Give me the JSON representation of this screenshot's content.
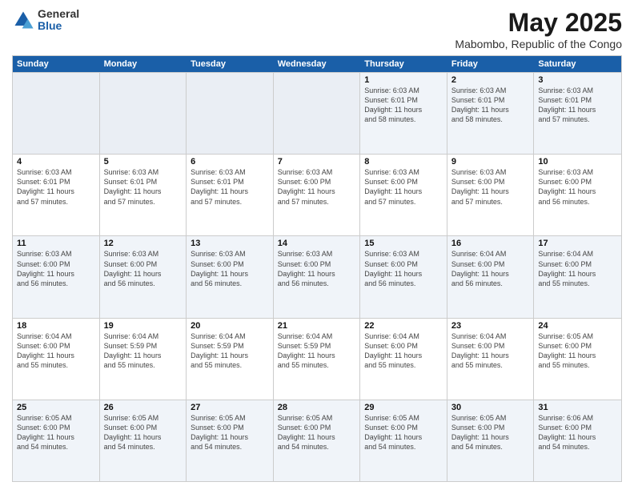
{
  "logo": {
    "general": "General",
    "blue": "Blue"
  },
  "header": {
    "title": "May 2025",
    "subtitle": "Mabombo, Republic of the Congo"
  },
  "weekdays": [
    "Sunday",
    "Monday",
    "Tuesday",
    "Wednesday",
    "Thursday",
    "Friday",
    "Saturday"
  ],
  "rows": [
    [
      {
        "day": "",
        "info": ""
      },
      {
        "day": "",
        "info": ""
      },
      {
        "day": "",
        "info": ""
      },
      {
        "day": "",
        "info": ""
      },
      {
        "day": "1",
        "info": "Sunrise: 6:03 AM\nSunset: 6:01 PM\nDaylight: 11 hours\nand 58 minutes."
      },
      {
        "day": "2",
        "info": "Sunrise: 6:03 AM\nSunset: 6:01 PM\nDaylight: 11 hours\nand 58 minutes."
      },
      {
        "day": "3",
        "info": "Sunrise: 6:03 AM\nSunset: 6:01 PM\nDaylight: 11 hours\nand 57 minutes."
      }
    ],
    [
      {
        "day": "4",
        "info": "Sunrise: 6:03 AM\nSunset: 6:01 PM\nDaylight: 11 hours\nand 57 minutes."
      },
      {
        "day": "5",
        "info": "Sunrise: 6:03 AM\nSunset: 6:01 PM\nDaylight: 11 hours\nand 57 minutes."
      },
      {
        "day": "6",
        "info": "Sunrise: 6:03 AM\nSunset: 6:01 PM\nDaylight: 11 hours\nand 57 minutes."
      },
      {
        "day": "7",
        "info": "Sunrise: 6:03 AM\nSunset: 6:00 PM\nDaylight: 11 hours\nand 57 minutes."
      },
      {
        "day": "8",
        "info": "Sunrise: 6:03 AM\nSunset: 6:00 PM\nDaylight: 11 hours\nand 57 minutes."
      },
      {
        "day": "9",
        "info": "Sunrise: 6:03 AM\nSunset: 6:00 PM\nDaylight: 11 hours\nand 57 minutes."
      },
      {
        "day": "10",
        "info": "Sunrise: 6:03 AM\nSunset: 6:00 PM\nDaylight: 11 hours\nand 56 minutes."
      }
    ],
    [
      {
        "day": "11",
        "info": "Sunrise: 6:03 AM\nSunset: 6:00 PM\nDaylight: 11 hours\nand 56 minutes."
      },
      {
        "day": "12",
        "info": "Sunrise: 6:03 AM\nSunset: 6:00 PM\nDaylight: 11 hours\nand 56 minutes."
      },
      {
        "day": "13",
        "info": "Sunrise: 6:03 AM\nSunset: 6:00 PM\nDaylight: 11 hours\nand 56 minutes."
      },
      {
        "day": "14",
        "info": "Sunrise: 6:03 AM\nSunset: 6:00 PM\nDaylight: 11 hours\nand 56 minutes."
      },
      {
        "day": "15",
        "info": "Sunrise: 6:03 AM\nSunset: 6:00 PM\nDaylight: 11 hours\nand 56 minutes."
      },
      {
        "day": "16",
        "info": "Sunrise: 6:04 AM\nSunset: 6:00 PM\nDaylight: 11 hours\nand 56 minutes."
      },
      {
        "day": "17",
        "info": "Sunrise: 6:04 AM\nSunset: 6:00 PM\nDaylight: 11 hours\nand 55 minutes."
      }
    ],
    [
      {
        "day": "18",
        "info": "Sunrise: 6:04 AM\nSunset: 6:00 PM\nDaylight: 11 hours\nand 55 minutes."
      },
      {
        "day": "19",
        "info": "Sunrise: 6:04 AM\nSunset: 5:59 PM\nDaylight: 11 hours\nand 55 minutes."
      },
      {
        "day": "20",
        "info": "Sunrise: 6:04 AM\nSunset: 5:59 PM\nDaylight: 11 hours\nand 55 minutes."
      },
      {
        "day": "21",
        "info": "Sunrise: 6:04 AM\nSunset: 5:59 PM\nDaylight: 11 hours\nand 55 minutes."
      },
      {
        "day": "22",
        "info": "Sunrise: 6:04 AM\nSunset: 6:00 PM\nDaylight: 11 hours\nand 55 minutes."
      },
      {
        "day": "23",
        "info": "Sunrise: 6:04 AM\nSunset: 6:00 PM\nDaylight: 11 hours\nand 55 minutes."
      },
      {
        "day": "24",
        "info": "Sunrise: 6:05 AM\nSunset: 6:00 PM\nDaylight: 11 hours\nand 55 minutes."
      }
    ],
    [
      {
        "day": "25",
        "info": "Sunrise: 6:05 AM\nSunset: 6:00 PM\nDaylight: 11 hours\nand 54 minutes."
      },
      {
        "day": "26",
        "info": "Sunrise: 6:05 AM\nSunset: 6:00 PM\nDaylight: 11 hours\nand 54 minutes."
      },
      {
        "day": "27",
        "info": "Sunrise: 6:05 AM\nSunset: 6:00 PM\nDaylight: 11 hours\nand 54 minutes."
      },
      {
        "day": "28",
        "info": "Sunrise: 6:05 AM\nSunset: 6:00 PM\nDaylight: 11 hours\nand 54 minutes."
      },
      {
        "day": "29",
        "info": "Sunrise: 6:05 AM\nSunset: 6:00 PM\nDaylight: 11 hours\nand 54 minutes."
      },
      {
        "day": "30",
        "info": "Sunrise: 6:05 AM\nSunset: 6:00 PM\nDaylight: 11 hours\nand 54 minutes."
      },
      {
        "day": "31",
        "info": "Sunrise: 6:06 AM\nSunset: 6:00 PM\nDaylight: 11 hours\nand 54 minutes."
      }
    ]
  ],
  "alt_rows": [
    0,
    2,
    4
  ]
}
